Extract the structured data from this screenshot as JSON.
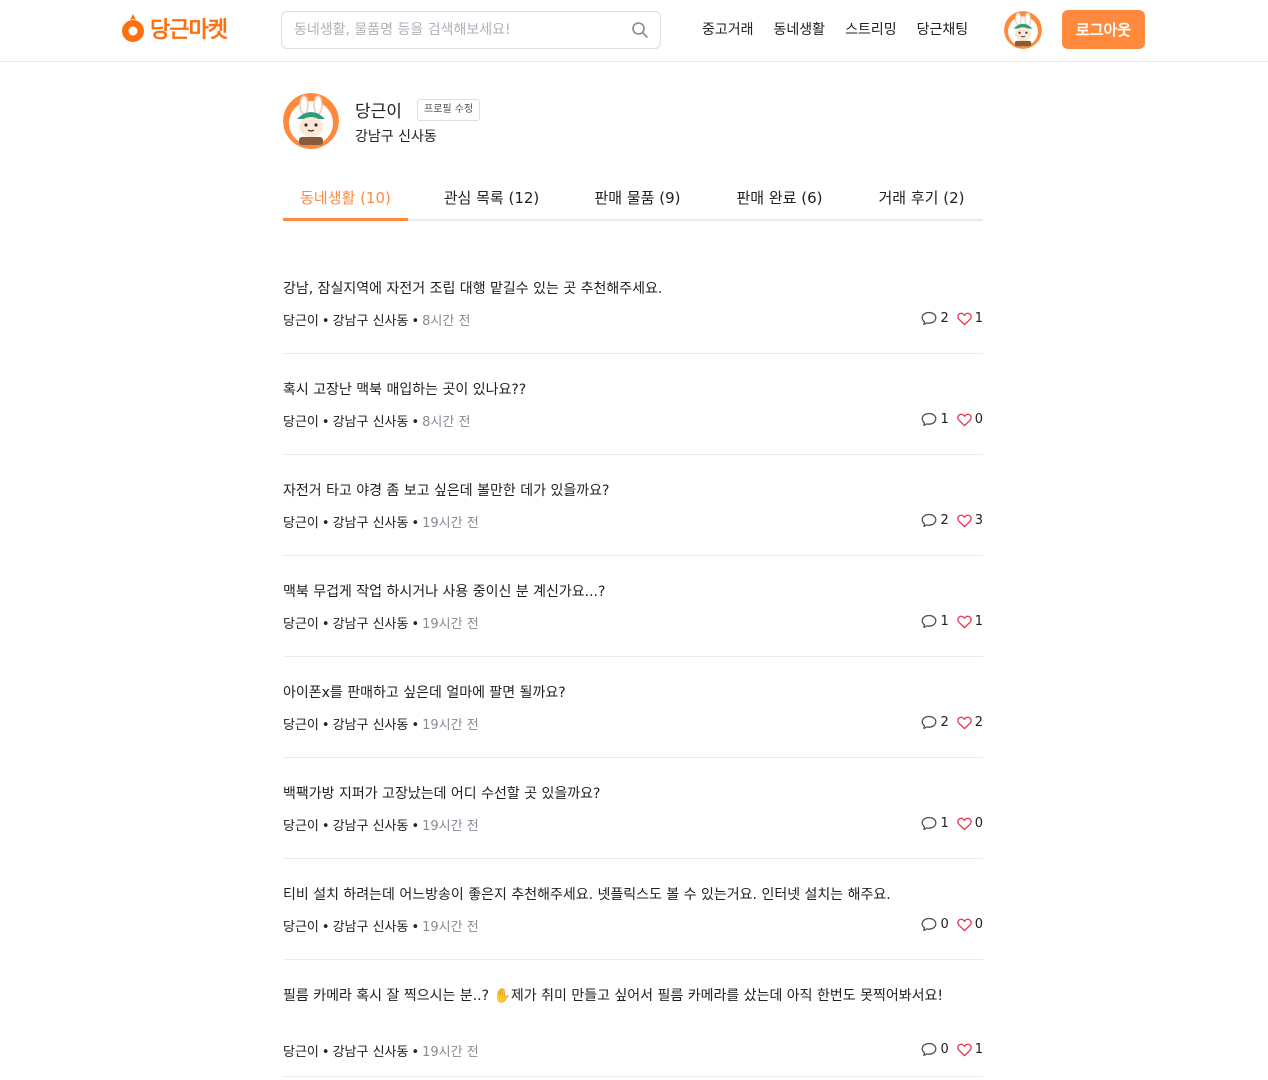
{
  "header": {
    "logo_text": "당근마켓",
    "search_placeholder": "동네생활, 물품명 등을 검색해보세요!",
    "nav": [
      "중고거래",
      "동네생활",
      "스트리밍",
      "당근채팅"
    ],
    "logout_label": "로그아웃"
  },
  "profile": {
    "name": "당근이",
    "edit_label": "프로필 수정",
    "region": "강남구 신사동"
  },
  "tabs": [
    {
      "label": "동네생활 (10)",
      "active": true
    },
    {
      "label": "관심 목록 (12)",
      "active": false
    },
    {
      "label": "판매 물품 (9)",
      "active": false
    },
    {
      "label": "판매 완료 (6)",
      "active": false
    },
    {
      "label": "거래 후기 (2)",
      "active": false
    }
  ],
  "posts": [
    {
      "title": "강남, 잠실지역에 자전거 조립 대행 맡길수 있는 곳 추천해주세요.",
      "author": "당근이",
      "region": "강남구 신사동",
      "time": "8시간 전",
      "comments": "2",
      "likes": "1"
    },
    {
      "title": "혹시 고장난 맥북 매입하는 곳이 있나요??",
      "author": "당근이",
      "region": "강남구 신사동",
      "time": "8시간 전",
      "comments": "1",
      "likes": "0"
    },
    {
      "title": "자전거 타고 야경 좀 보고 싶은데 볼만한 데가 있을까요?",
      "author": "당근이",
      "region": "강남구 신사동",
      "time": "19시간 전",
      "comments": "2",
      "likes": "3"
    },
    {
      "title": "맥북 무겁게 작업 하시거나 사용 중이신 분 계신가요...?",
      "author": "당근이",
      "region": "강남구 신사동",
      "time": "19시간 전",
      "comments": "1",
      "likes": "1"
    },
    {
      "title": "아이폰x를 판매하고 싶은데 얼마에 팔면 될까요?",
      "author": "당근이",
      "region": "강남구 신사동",
      "time": "19시간 전",
      "comments": "2",
      "likes": "2"
    },
    {
      "title": "백팩가방 지퍼가 고장났는데 어디 수선할 곳 있을까요?",
      "author": "당근이",
      "region": "강남구 신사동",
      "time": "19시간 전",
      "comments": "1",
      "likes": "0"
    },
    {
      "title": "티비 설치 하려는데 어느방송이 좋은지 추천해주세요. 넷플릭스도 볼 수 있는거요. 인터넷 설치는 해주요.",
      "author": "당근이",
      "region": "강남구 신사동",
      "time": "19시간 전",
      "comments": "0",
      "likes": "0"
    },
    {
      "title": "필름 카메라 혹시 잘 찍으시는 분..? ✋제가 취미 만들고 싶어서 필름 카메라를 샀는데 아직 한번도 못찍어봐서요!",
      "author": "당근이",
      "region": "강남구 신사동",
      "time": "19시간 전",
      "comments": "0",
      "likes": "1"
    }
  ],
  "colors": {
    "accent": "#ff8a3d",
    "logo": "#ff6f0f",
    "like": "#e8344e"
  }
}
